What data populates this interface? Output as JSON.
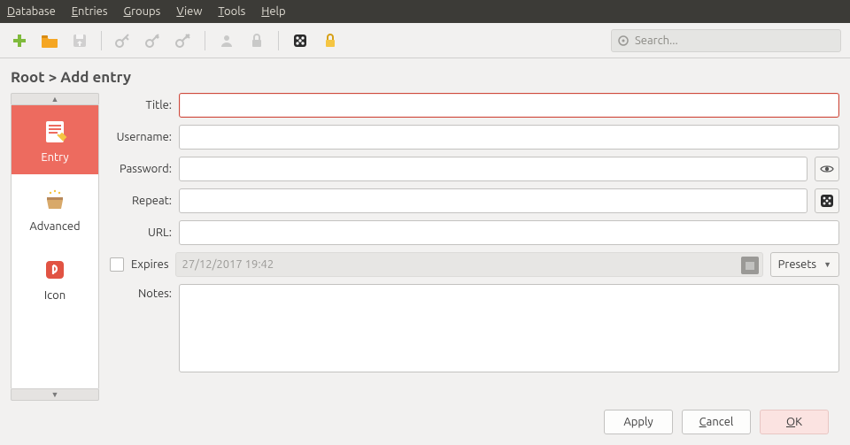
{
  "menubar": {
    "items": [
      {
        "pre": "D",
        "rest": "atabase"
      },
      {
        "pre": "E",
        "rest": "ntries"
      },
      {
        "pre": "G",
        "rest": "roups"
      },
      {
        "pre": "V",
        "rest": "iew"
      },
      {
        "pre": "T",
        "rest": "ools"
      },
      {
        "pre": "H",
        "rest": "elp"
      }
    ]
  },
  "toolbar": {
    "search_placeholder": "Search..."
  },
  "breadcrumb": "Root > Add entry",
  "sidebar": {
    "tabs": [
      {
        "label": "Entry"
      },
      {
        "label": "Advanced"
      },
      {
        "label": "Icon"
      }
    ]
  },
  "form": {
    "title_label": "Title:",
    "username_label": "Username:",
    "password_label": "Password:",
    "repeat_label": "Repeat:",
    "url_label": "URL:",
    "expires_label": "Expires",
    "expires_value": "27/12/2017 19:42",
    "presets_label": "Presets",
    "notes_label": "Notes:",
    "title_value": "",
    "username_value": "",
    "password_value": "",
    "repeat_value": "",
    "url_value": "",
    "notes_value": ""
  },
  "buttons": {
    "apply": "Apply",
    "cancel_pre": "C",
    "cancel_rest": "ancel",
    "ok_pre": "O",
    "ok_rest": "K"
  }
}
